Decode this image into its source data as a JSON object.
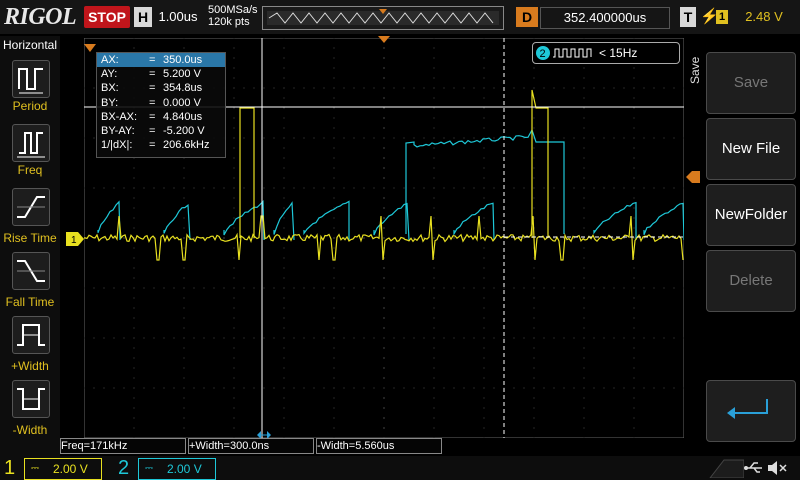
{
  "header": {
    "logo": "RIGOL",
    "run_state": "STOP",
    "h_label": "H",
    "timebase": "1.00us",
    "sample_rate": "500MSa/s",
    "mem_depth": "120k pts",
    "delay_label": "D",
    "delay_value": "352.400000us",
    "trig_label": "T",
    "trig_channel": "1",
    "trig_level": "2.48 V"
  },
  "left_panel": {
    "title": "Horizontal",
    "items": [
      {
        "label": "Period"
      },
      {
        "label": "Freq"
      },
      {
        "label": "Rise Time"
      },
      {
        "label": "Fall Time"
      },
      {
        "label": "+Width"
      },
      {
        "label": "-Width"
      }
    ]
  },
  "right_panel": {
    "tab": "Save",
    "buttons": [
      {
        "label": "Save",
        "enabled": false
      },
      {
        "label": "New File",
        "enabled": true
      },
      {
        "label": "NewFolder",
        "enabled": true
      },
      {
        "label": "Delete",
        "enabled": false
      }
    ]
  },
  "trigger_box": {
    "channel": "2",
    "text": "< 15Hz"
  },
  "cursor_readout": [
    {
      "name": "AX:",
      "eq": "=",
      "value": "350.0us"
    },
    {
      "name": "AY:",
      "eq": "=",
      "value": "5.200 V"
    },
    {
      "name": "BX:",
      "eq": "=",
      "value": "354.8us"
    },
    {
      "name": "BY:",
      "eq": "=",
      "value": "0.000 V"
    },
    {
      "name": "BX-AX:",
      "eq": "=",
      "value": "4.840us"
    },
    {
      "name": "BY-AY:",
      "eq": "=",
      "value": "-5.200 V"
    },
    {
      "name": "1/|dX|:",
      "eq": "=",
      "value": "206.6kHz"
    }
  ],
  "measurements": {
    "freq": "Freq=171kHz",
    "pwidth": "+Width=300.0ns",
    "nwidth": "-Width=5.560us"
  },
  "channels": {
    "ch1": {
      "num": "1",
      "scale": "2.00 V",
      "color": "#e8e020"
    },
    "ch2": {
      "num": "2",
      "scale": "2.00 V",
      "color": "#1ec8d8"
    }
  },
  "markers": {
    "ch1_level": "1",
    "cursor_a": "A",
    "cursor_b": "B"
  }
}
